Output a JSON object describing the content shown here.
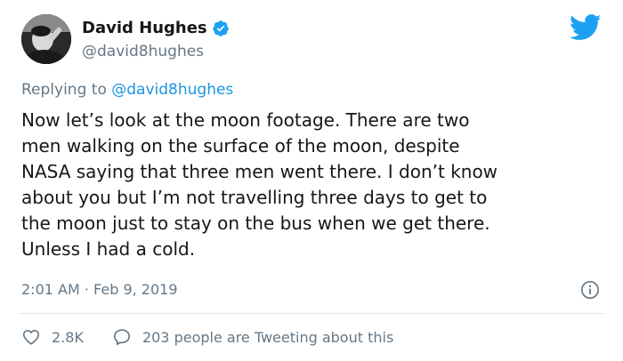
{
  "author": {
    "name": "David Hughes",
    "handle": "@david8hughes",
    "verified": true
  },
  "reply": {
    "prefix": "Replying to",
    "handle": "@david8hughes"
  },
  "tweet": {
    "text": "Now let’s look at the moon footage. There are two\nmen walking on the surface of the moon, despite\nNASA saying that three men went there. I don’t know\nabout you but I’m not travelling three days to get to\nthe moon just to stay on the bus when we get there.\nUnless I had a cold.",
    "timestamp": "2:01 AM · Feb 9, 2019"
  },
  "actions": {
    "likes": "2.8K",
    "conversation": "203 people are Tweeting about this"
  },
  "colors": {
    "accent": "#1da1f2",
    "link": "#1b95e0",
    "muted": "#657786",
    "text": "#14171a",
    "divider": "#e1e8ed"
  },
  "icons": {
    "brand": "twitter-bird-icon",
    "verified": "verified-badge-icon",
    "info": "info-icon",
    "like": "heart-icon",
    "conversation": "speech-bubble-icon"
  }
}
